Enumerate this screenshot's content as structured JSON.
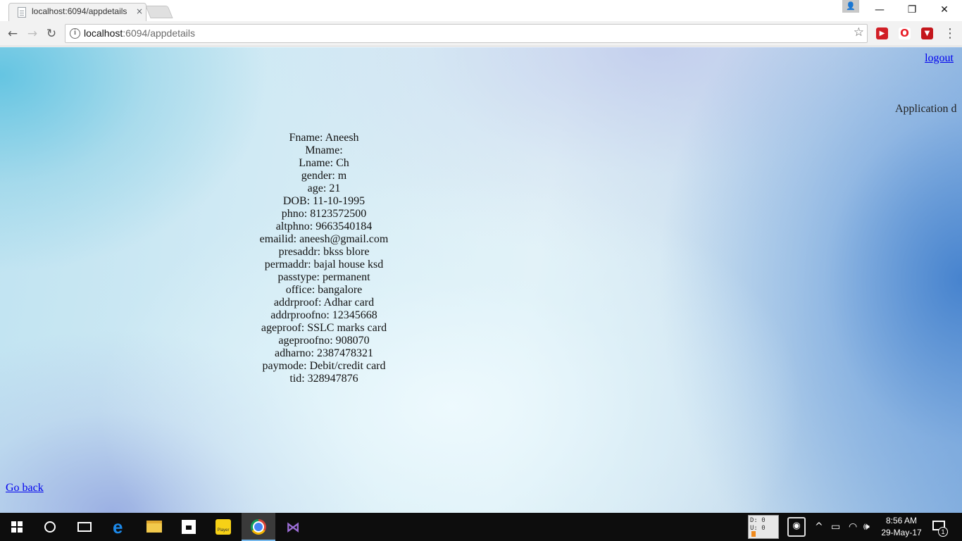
{
  "browser": {
    "tab": {
      "title": "localhost:6094/appdetails",
      "close": "×"
    },
    "address": {
      "host": "localhost",
      "path": ":6094/appdetails"
    },
    "window_controls": {
      "minimize": "—",
      "maximize": "❐",
      "close": "✕"
    },
    "nav": {
      "back": "←",
      "forward": "→",
      "reload": "↻"
    },
    "star": "☆",
    "menu": "⋮",
    "extensions": [
      {
        "name": "record-extension",
        "color": "#d11f26",
        "glyph": "▶"
      },
      {
        "name": "opera-extension",
        "color": "#e8202a",
        "glyph": "O"
      },
      {
        "name": "shield-extension",
        "color": "#c4161c",
        "glyph": "▼"
      }
    ]
  },
  "page": {
    "logout_label": "logout",
    "heading": "Application d",
    "details": [
      "Fname: Aneesh",
      "Mname:",
      "Lname: Ch",
      "gender: m",
      "age: 21",
      "DOB: 11-10-1995",
      "phno: 8123572500",
      "altphno: 9663540184",
      "emailid: aneesh@gmail.com",
      "presaddr: bkss blore",
      "permaddr: bajal house ksd",
      "passtype: permanent",
      "office: bangalore",
      "addrproof: Adhar card",
      "addrproofno: 12345668",
      "ageproof: SSLC marks card",
      "ageproofno: 908070",
      "adharno: 2387478321",
      "paymode: Debit/credit card",
      "tid: 328947876"
    ],
    "goback_label": "Go back"
  },
  "taskbar": {
    "du_meter": {
      "down": "D: 0",
      "up": "U: 0"
    },
    "player_label": "Player",
    "clock": {
      "time": "8:56 AM",
      "date": "29-May-17"
    },
    "tray": {
      "chevron": "^",
      "battery": "▭",
      "wifi": "◠",
      "volume": "🕪"
    },
    "notification_count": "1"
  }
}
